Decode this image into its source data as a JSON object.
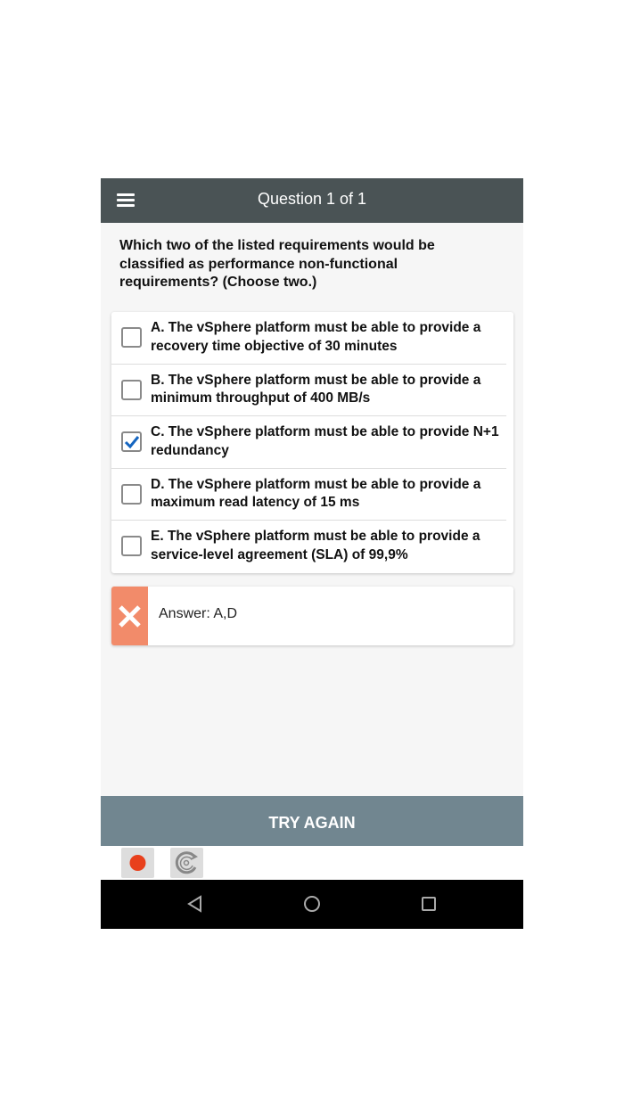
{
  "header": {
    "title": "Question 1 of 1",
    "menu_icon": "hamburger-menu-icon"
  },
  "question": "Which two of the listed requirements would be classified as performance non-functional requirements? (Choose two.)",
  "options": [
    {
      "label": "A. The vSphere platform must be able to provide a recovery time objective of 30 minutes",
      "checked": false
    },
    {
      "label": "B. The vSphere platform must be able to provide a minimum throughput of 400 MB/s",
      "checked": false
    },
    {
      "label": "C. The vSphere platform must be able to provide N+1 redundancy",
      "checked": true
    },
    {
      "label": "D. The vSphere platform must be able to provide a maximum read latency of 15 ms",
      "checked": false
    },
    {
      "label": "E. The vSphere platform must be able to provide a service-level agreement (SLA) of 99,9%",
      "checked": false
    }
  ],
  "result": {
    "text": "Answer: A,D",
    "status": "incorrect",
    "icon": "x-icon",
    "color": "#f28b6a"
  },
  "try_again_label": "TRY AGAIN",
  "colors": {
    "header": "#4a5355",
    "button": "#718690",
    "check": "#1565c0",
    "record": "#e8401c"
  }
}
